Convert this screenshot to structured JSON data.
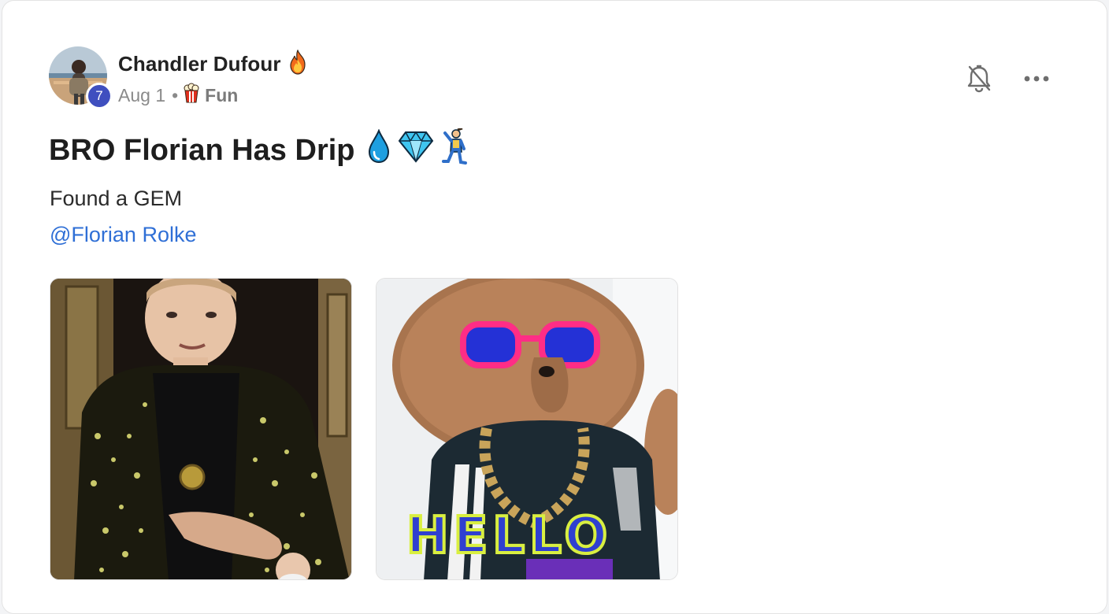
{
  "post": {
    "author": {
      "name": "Chandler Dufour",
      "level": "7",
      "flair_icon": "fire-emoji"
    },
    "meta": {
      "date": "Aug 1",
      "separator": "•",
      "category": "Fun",
      "category_icon": "popcorn-emoji"
    },
    "title": "BRO Florian Has Drip",
    "title_icons": [
      "droplet-emoji",
      "gem-emoji",
      "dancing-man-emoji"
    ],
    "body": "Found a GEM",
    "mention": "@Florian Rolke",
    "actions": {
      "bell_icon": "bell-muted-icon",
      "more_icon": "more-horizontal-icon"
    },
    "media": [
      {
        "name": "man-in-patterned-jacket-gif"
      },
      {
        "name": "poodle-sunglasses-hello-gif",
        "caption": "HELLO"
      }
    ]
  },
  "colors": {
    "badge": "#3f4fbf",
    "link": "#2f6fd6",
    "text": "#1e1e1e",
    "muted": "#8a8a8a"
  }
}
